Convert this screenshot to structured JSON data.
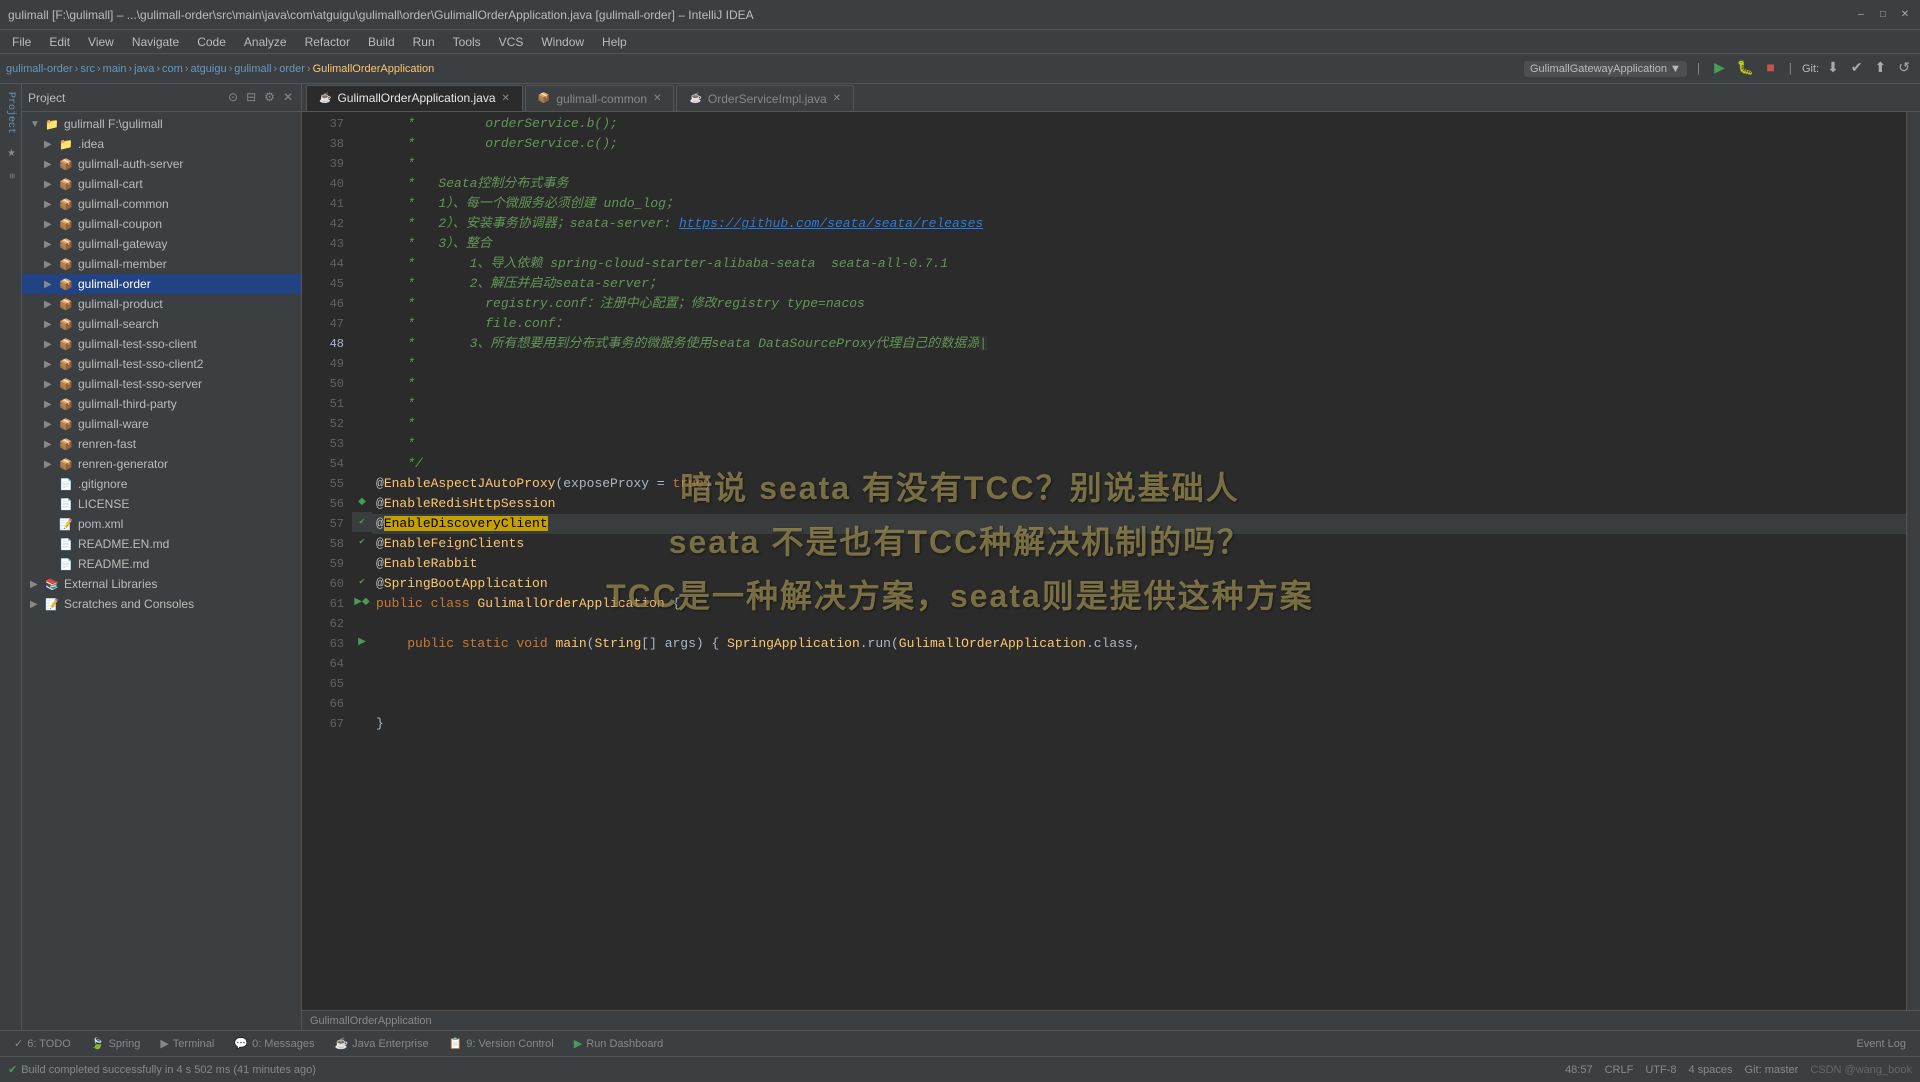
{
  "window": {
    "title": "gulimall [F:\\gulimall] – ...\\gulimall-order\\src\\main\\java\\com\\atguigu\\gulimall\\order\\GulimallOrderApplication.java [gulimall-order] – IntelliJ IDEA",
    "controls": [
      "–",
      "□",
      "✕"
    ]
  },
  "overlay": {
    "lines": [
      "暗说 seata 有没有TCC？别说基础人",
      "seata 不是也有TCC种解决机制的吗？",
      "TCC是一种解决方案，seata则是提供这种方案"
    ]
  },
  "menu": {
    "items": [
      "File",
      "Edit",
      "View",
      "Navigate",
      "Code",
      "Analyze",
      "Refactor",
      "Build",
      "Run",
      "Tools",
      "VCS",
      "Window",
      "Help"
    ]
  },
  "toolbar": {
    "breadcrumb": [
      "gulimall-order",
      "src",
      "main",
      "java",
      "com",
      "atguigu",
      "gulimall",
      "order",
      "GulimallOrderApplication"
    ],
    "run_config": "GulimallGatewayApplication",
    "git_label": "Git:"
  },
  "tabs": [
    {
      "label": "GulimallOrderApplication.java",
      "active": true
    },
    {
      "label": "gulimall-common",
      "active": false
    },
    {
      "label": "OrderServiceImpl.java",
      "active": false
    }
  ],
  "sidebar": {
    "title": "Project",
    "root": "gulimall F:\\gulimall",
    "items": [
      {
        "label": ".idea",
        "indent": 2,
        "type": "folder",
        "expanded": false
      },
      {
        "label": "gulimall-auth-server",
        "indent": 1,
        "type": "module",
        "expanded": false
      },
      {
        "label": "gulimall-cart",
        "indent": 1,
        "type": "module",
        "expanded": false
      },
      {
        "label": "gulimall-common",
        "indent": 1,
        "type": "module",
        "expanded": false
      },
      {
        "label": "gulimall-coupon",
        "indent": 1,
        "type": "module",
        "expanded": false
      },
      {
        "label": "gulimall-gateway",
        "indent": 1,
        "type": "module",
        "expanded": false
      },
      {
        "label": "gulimall-member",
        "indent": 1,
        "type": "module",
        "expanded": false
      },
      {
        "label": "gulimall-order",
        "indent": 1,
        "type": "module",
        "expanded": false,
        "selected": true
      },
      {
        "label": "gulimall-product",
        "indent": 1,
        "type": "module",
        "expanded": false
      },
      {
        "label": "gulimall-search",
        "indent": 1,
        "type": "module",
        "expanded": false
      },
      {
        "label": "gulimall-test-sso-client",
        "indent": 1,
        "type": "module",
        "expanded": false
      },
      {
        "label": "gulimall-test-sso-client2",
        "indent": 1,
        "type": "module",
        "expanded": false
      },
      {
        "label": "gulimall-test-sso-server",
        "indent": 1,
        "type": "module",
        "expanded": false
      },
      {
        "label": "gulimall-third-party",
        "indent": 1,
        "type": "module",
        "expanded": false
      },
      {
        "label": "gulimall-ware",
        "indent": 1,
        "type": "module",
        "expanded": false
      },
      {
        "label": "renren-fast",
        "indent": 1,
        "type": "module",
        "expanded": false
      },
      {
        "label": "renren-generator",
        "indent": 1,
        "type": "module",
        "expanded": false
      },
      {
        "label": ".gitignore",
        "indent": 1,
        "type": "file"
      },
      {
        "label": "LICENSE",
        "indent": 1,
        "type": "file"
      },
      {
        "label": "pom.xml",
        "indent": 1,
        "type": "xml"
      },
      {
        "label": "README.EN.md",
        "indent": 1,
        "type": "file"
      },
      {
        "label": "README.md",
        "indent": 1,
        "type": "file"
      },
      {
        "label": "External Libraries",
        "indent": 0,
        "type": "folder",
        "expanded": false
      },
      {
        "label": "Scratches and Consoles",
        "indent": 0,
        "type": "folder",
        "expanded": false
      }
    ]
  },
  "code": {
    "filename_footer": "GulimallOrderApplication",
    "lines": [
      {
        "num": 37,
        "content": "    *         orderService.b();",
        "type": "comment"
      },
      {
        "num": 38,
        "content": "    *         orderService.c();",
        "type": "comment"
      },
      {
        "num": 39,
        "content": "    *",
        "type": "comment"
      },
      {
        "num": 40,
        "content": "    *   Seata控制分布式事务",
        "type": "comment"
      },
      {
        "num": 41,
        "content": "    *   1）、每一个微服务必须创建 undo_log；",
        "type": "comment"
      },
      {
        "num": 42,
        "content": "    *   2）、安装事务协调器；seata-server: https://github.com/seata/seata/releases",
        "type": "comment"
      },
      {
        "num": 43,
        "content": "    *   3）、整合",
        "type": "comment"
      },
      {
        "num": 44,
        "content": "    *       1、导入依赖 spring-cloud-starter-alibaba-seata  seata-all-0.7.1",
        "type": "comment"
      },
      {
        "num": 45,
        "content": "    *       2、解压并启动seata-server；",
        "type": "comment"
      },
      {
        "num": 46,
        "content": "    *         registry.conf：注册中心配置；修改registry type=nacos",
        "type": "comment"
      },
      {
        "num": 47,
        "content": "    *         file.conf：",
        "type": "comment"
      },
      {
        "num": 48,
        "content": "    *       3、所有想要用到分布式事务的微服务使用seata DataSourceProxy代理自己的数据源",
        "type": "comment"
      },
      {
        "num": 49,
        "content": "    *",
        "type": "comment"
      },
      {
        "num": 50,
        "content": "    *",
        "type": "comment"
      },
      {
        "num": 51,
        "content": "    *",
        "type": "comment"
      },
      {
        "num": 52,
        "content": "    *",
        "type": "comment"
      },
      {
        "num": 53,
        "content": "    *",
        "type": "comment"
      },
      {
        "num": 54,
        "content": "    */",
        "type": "comment"
      },
      {
        "num": 55,
        "content": "@EnableAspectJAutoProxy(exposeProxy = true)",
        "type": "annotation"
      },
      {
        "num": 56,
        "content": "@EnableRedisHttpSession",
        "type": "annotation"
      },
      {
        "num": 57,
        "content": "@EnableDiscoveryClient",
        "type": "annotation",
        "highlight": true
      },
      {
        "num": 58,
        "content": "@EnableFeignClients",
        "type": "annotation"
      },
      {
        "num": 59,
        "content": "@EnableRabbit",
        "type": "annotation"
      },
      {
        "num": 60,
        "content": "@SpringBootApplication",
        "type": "annotation"
      },
      {
        "num": 61,
        "content": "public class GulimallOrderApplication {",
        "type": "code"
      },
      {
        "num": 62,
        "content": "",
        "type": "empty"
      },
      {
        "num": 63,
        "content": "    public static void main(String[] args) { SpringApplication.run(GulimallOrderApplication.class,",
        "type": "code"
      },
      {
        "num": 64,
        "content": "",
        "type": "empty"
      },
      {
        "num": 65,
        "content": "",
        "type": "empty"
      },
      {
        "num": 66,
        "content": "",
        "type": "empty"
      },
      {
        "num": 67,
        "content": "}",
        "type": "code"
      }
    ]
  },
  "status_bar": {
    "position": "48:57",
    "line_ending": "CRLF",
    "encoding": "UTF-8",
    "indent": "4 spaces",
    "git": "Git: master",
    "build_message": "Build completed successfully in 4 s 502 ms (41 minutes ago)"
  },
  "bottom_tabs": [
    {
      "label": "6: TODO",
      "icon": "✓"
    },
    {
      "label": "Spring",
      "icon": "🍃"
    },
    {
      "label": "Terminal",
      "icon": ">"
    },
    {
      "label": "0: Messages",
      "icon": "💬"
    },
    {
      "label": "Java Enterprise",
      "icon": "☕"
    },
    {
      "label": "9: Version Control",
      "icon": "📋"
    },
    {
      "label": "Run Dashboard",
      "icon": "▶"
    }
  ],
  "event_log_label": "Event Log",
  "csdn_watermark": "CSDN @wang_book"
}
